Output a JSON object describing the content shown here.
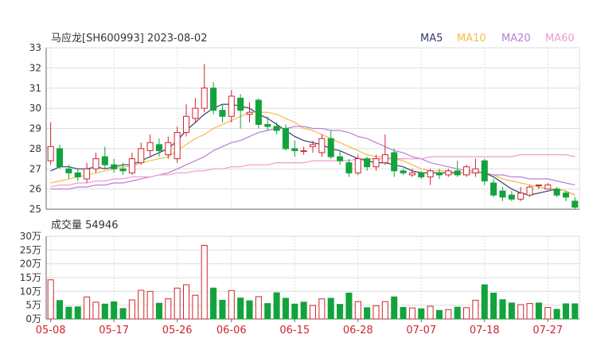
{
  "header": {
    "title": "马应龙[SH600993] 2023-08-02"
  },
  "legend": [
    {
      "label": "MA5",
      "color": "#333b6e"
    },
    {
      "label": "MA10",
      "color": "#f5b94a"
    },
    {
      "label": "MA20",
      "color": "#b77fd6"
    },
    {
      "label": "MA60",
      "color": "#f09ad0"
    }
  ],
  "volume_panel": {
    "label": "成交量 54946"
  },
  "colors": {
    "up": "#d0252f",
    "down": "#12a33c",
    "grid": "#dddddd",
    "axis": "#666666"
  },
  "chart_data": [
    {
      "type": "candlestick",
      "title": "马应龙[SH600993] 2023-08-02",
      "ylim": [
        25,
        33
      ],
      "y_ticks": [
        "33",
        "32",
        "31",
        "30",
        "29",
        "28",
        "27",
        "26",
        "25"
      ],
      "x_ticks": [
        {
          "label": "05-08",
          "index": 0
        },
        {
          "label": "05-17",
          "index": 7
        },
        {
          "label": "05-26",
          "index": 14
        },
        {
          "label": "06-06",
          "index": 20
        },
        {
          "label": "06-15",
          "index": 27
        },
        {
          "label": "06-28",
          "index": 34
        },
        {
          "label": "07-07",
          "index": 41
        },
        {
          "label": "07-18",
          "index": 48
        },
        {
          "label": "07-27",
          "index": 55
        }
      ],
      "candles": [
        [
          27.4,
          28.1,
          29.3,
          27.2
        ],
        [
          28.0,
          27.1,
          28.2,
          27.0
        ],
        [
          27.0,
          26.8,
          27.2,
          26.5
        ],
        [
          26.8,
          26.6,
          27.0,
          26.4
        ],
        [
          26.5,
          27.0,
          27.3,
          26.3
        ],
        [
          27.0,
          27.5,
          27.8,
          26.8
        ],
        [
          27.6,
          27.2,
          28.1,
          27.0
        ],
        [
          27.2,
          27.0,
          27.5,
          26.8
        ],
        [
          27.0,
          26.9,
          27.3,
          26.7
        ],
        [
          26.8,
          27.5,
          27.8,
          26.7
        ],
        [
          27.3,
          28.0,
          28.3,
          27.2
        ],
        [
          27.9,
          28.3,
          28.7,
          27.6
        ],
        [
          28.2,
          27.9,
          28.5,
          27.6
        ],
        [
          27.7,
          28.3,
          28.6,
          27.5
        ],
        [
          27.5,
          28.8,
          29.1,
          27.3
        ],
        [
          28.8,
          29.6,
          30.2,
          28.6
        ],
        [
          29.5,
          30.0,
          30.5,
          29.3
        ],
        [
          30.0,
          31.0,
          32.2,
          29.8
        ],
        [
          31.0,
          29.9,
          31.3,
          29.7
        ],
        [
          29.9,
          29.6,
          30.2,
          29.3
        ],
        [
          29.6,
          30.6,
          30.9,
          29.3
        ],
        [
          30.5,
          29.9,
          30.7,
          29.0
        ],
        [
          29.7,
          29.8,
          30.3,
          29.3
        ],
        [
          30.4,
          29.2,
          30.5,
          29.0
        ],
        [
          29.2,
          29.1,
          29.6,
          28.9
        ],
        [
          29.1,
          28.9,
          29.3,
          28.7
        ],
        [
          29.0,
          28.0,
          29.2,
          27.9
        ],
        [
          28.0,
          27.9,
          28.4,
          27.6
        ],
        [
          27.9,
          27.9,
          28.1,
          27.7
        ],
        [
          28.1,
          28.2,
          28.4,
          27.8
        ],
        [
          27.8,
          28.5,
          28.7,
          27.6
        ],
        [
          28.5,
          27.6,
          28.9,
          27.5
        ],
        [
          27.6,
          27.4,
          27.9,
          27.2
        ],
        [
          27.3,
          26.8,
          27.5,
          26.6
        ],
        [
          26.8,
          27.5,
          27.7,
          26.7
        ],
        [
          27.5,
          27.1,
          27.6,
          26.9
        ],
        [
          27.1,
          27.5,
          27.7,
          26.9
        ],
        [
          27.3,
          27.7,
          28.7,
          27.2
        ],
        [
          27.8,
          26.9,
          28.0,
          26.6
        ],
        [
          26.9,
          26.8,
          27.0,
          26.7
        ],
        [
          26.7,
          26.8,
          27.0,
          26.6
        ],
        [
          26.8,
          26.6,
          26.9,
          26.5
        ],
        [
          26.6,
          26.9,
          27.0,
          26.2
        ],
        [
          26.8,
          26.7,
          27.0,
          26.5
        ],
        [
          26.7,
          26.9,
          27.0,
          26.6
        ],
        [
          26.9,
          26.7,
          27.4,
          26.6
        ],
        [
          26.7,
          27.1,
          27.2,
          26.6
        ],
        [
          26.8,
          27.0,
          27.5,
          26.6
        ],
        [
          27.4,
          26.4,
          27.5,
          26.2
        ],
        [
          26.3,
          25.7,
          26.5,
          25.6
        ],
        [
          25.9,
          25.6,
          26.1,
          25.4
        ],
        [
          25.7,
          25.5,
          25.9,
          25.4
        ],
        [
          25.5,
          25.8,
          26.1,
          25.4
        ],
        [
          25.7,
          26.1,
          26.2,
          25.6
        ],
        [
          26.2,
          26.2,
          26.2,
          26.0
        ],
        [
          26.0,
          26.2,
          26.3,
          26.0
        ],
        [
          26.0,
          25.7,
          26.1,
          25.6
        ],
        [
          25.8,
          25.6,
          25.9,
          25.4
        ],
        [
          25.4,
          25.1,
          25.6,
          25.0
        ]
      ],
      "ma": {
        "MA5": [
          26.9,
          27.1,
          27.1,
          27.0,
          27.0,
          27.1,
          27.0,
          27.1,
          27.2,
          27.2,
          27.4,
          27.6,
          27.8,
          28.0,
          28.4,
          28.9,
          29.3,
          29.7,
          30.0,
          30.2,
          30.2,
          30.1,
          30.0,
          29.7,
          29.5,
          29.2,
          28.9,
          28.6,
          28.4,
          28.3,
          28.2,
          28.0,
          27.9,
          27.7,
          27.5,
          27.4,
          27.3,
          27.3,
          27.2,
          27.1,
          26.9,
          26.8,
          26.8,
          26.8,
          26.8,
          26.8,
          26.8,
          26.8,
          26.8,
          26.6,
          26.3,
          26.0,
          25.8,
          25.7,
          25.8,
          25.9,
          26.0,
          25.9,
          25.7
        ],
        "MA10": [
          26.3,
          26.4,
          26.5,
          26.6,
          26.7,
          26.8,
          26.9,
          27.0,
          27.1,
          27.1,
          27.3,
          27.4,
          27.5,
          27.6,
          27.9,
          28.2,
          28.5,
          28.7,
          29.0,
          29.2,
          29.4,
          29.6,
          29.8,
          29.8,
          29.8,
          29.7,
          29.5,
          29.3,
          29.0,
          28.9,
          28.7,
          28.5,
          28.3,
          28.1,
          27.9,
          27.7,
          27.6,
          27.6,
          27.5,
          27.4,
          27.2,
          27.0,
          26.9,
          26.9,
          26.9,
          26.8,
          26.8,
          26.8,
          26.8,
          26.7,
          26.5,
          26.4,
          26.3,
          26.2,
          26.1,
          26.0,
          26.0,
          25.9,
          25.7
        ],
        "MA20": [
          26.0,
          26.0,
          26.0,
          26.1,
          26.1,
          26.2,
          26.2,
          26.3,
          26.3,
          26.4,
          26.5,
          26.6,
          26.7,
          26.8,
          27.0,
          27.2,
          27.4,
          27.6,
          27.9,
          28.1,
          28.3,
          28.4,
          28.6,
          28.8,
          28.9,
          29.0,
          29.0,
          29.1,
          29.1,
          29.0,
          29.0,
          28.9,
          28.9,
          28.8,
          28.6,
          28.5,
          28.3,
          28.1,
          27.9,
          27.8,
          27.6,
          27.5,
          27.3,
          27.2,
          27.1,
          27.0,
          26.9,
          26.9,
          26.8,
          26.7,
          26.7,
          26.6,
          26.6,
          26.5,
          26.5,
          26.5,
          26.4,
          26.3,
          26.2
        ],
        "MA60": [
          26.1,
          26.2,
          26.2,
          26.3,
          26.3,
          26.4,
          26.4,
          26.5,
          26.5,
          26.6,
          26.6,
          26.6,
          26.7,
          26.7,
          26.8,
          26.8,
          26.9,
          26.9,
          27.0,
          27.0,
          27.1,
          27.1,
          27.2,
          27.2,
          27.2,
          27.3,
          27.3,
          27.3,
          27.3,
          27.4,
          27.4,
          27.4,
          27.4,
          27.4,
          27.5,
          27.5,
          27.5,
          27.5,
          27.5,
          27.5,
          27.5,
          27.5,
          27.6,
          27.6,
          27.6,
          27.6,
          27.6,
          27.6,
          27.6,
          27.6,
          27.6,
          27.6,
          27.7,
          27.7,
          27.7,
          27.7,
          27.7,
          27.7,
          27.6
        ]
      }
    },
    {
      "type": "bar",
      "title": "成交量 54946",
      "ylim": [
        0,
        30
      ],
      "y_ticks": [
        "30万",
        "25万",
        "20万",
        "15万",
        "10万",
        "5万",
        "0万"
      ],
      "values": [
        14.2,
        6.7,
        4.3,
        4.4,
        8.0,
        6.1,
        5.4,
        6.2,
        3.8,
        6.9,
        10.4,
        10.0,
        5.7,
        7.3,
        11.2,
        12.4,
        8.6,
        26.7,
        11.2,
        6.8,
        10.3,
        7.6,
        6.6,
        8.1,
        5.6,
        9.5,
        7.5,
        5.4,
        6.1,
        4.9,
        7.3,
        7.5,
        5.3,
        9.4,
        6.3,
        4.1,
        4.8,
        6.3,
        8.0,
        4.2,
        4.0,
        3.7,
        4.6,
        3.1,
        3.4,
        4.3,
        4.1,
        6.8,
        12.4,
        9.4,
        7.0,
        5.8,
        5.2,
        5.6,
        5.8,
        4.2,
        3.5,
        5.5,
        5.5
      ],
      "up": [
        true,
        false,
        false,
        false,
        true,
        true,
        false,
        false,
        false,
        true,
        true,
        true,
        false,
        true,
        true,
        true,
        true,
        true,
        false,
        false,
        true,
        false,
        false,
        true,
        false,
        false,
        false,
        false,
        false,
        true,
        true,
        false,
        false,
        false,
        true,
        false,
        true,
        true,
        false,
        false,
        true,
        false,
        true,
        false,
        true,
        false,
        true,
        true,
        false,
        false,
        false,
        false,
        true,
        true,
        false,
        true,
        false,
        false,
        false
      ]
    }
  ]
}
